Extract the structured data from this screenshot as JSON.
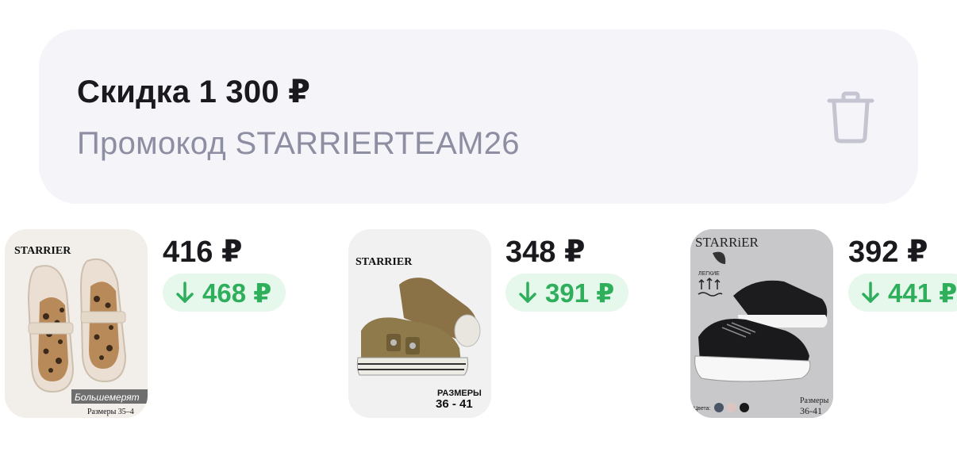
{
  "promo": {
    "title": "Скидка 1 300 ₽",
    "code_label": "Промокод STARRIERTEAM26",
    "delete_icon": "trash-icon"
  },
  "products": [
    {
      "price": "416 ₽",
      "old_price": "468 ₽",
      "image": {
        "brand": "STARRIER",
        "tag": "Большемерят",
        "sizes_label": "Размеры 35–4"
      }
    },
    {
      "price": "348 ₽",
      "old_price": "391 ₽",
      "image": {
        "brand": "STARRIER",
        "sizes_title": "РАЗМЕРЫ",
        "sizes_range": "36 - 41"
      }
    },
    {
      "price": "392 ₽",
      "old_price": "441 ₽",
      "image": {
        "brand": "STARRiER",
        "feature": "ЛЕГКИЕ",
        "colors_label": "Цвета:",
        "sizes_title": "Размеры",
        "sizes_range": "36-41"
      }
    }
  ],
  "colors": {
    "price_drop_text": "#2fae5c",
    "price_drop_bg": "#e6f7ec",
    "promo_bg": "#f4f4f9",
    "muted_text": "#8e8ea3"
  }
}
